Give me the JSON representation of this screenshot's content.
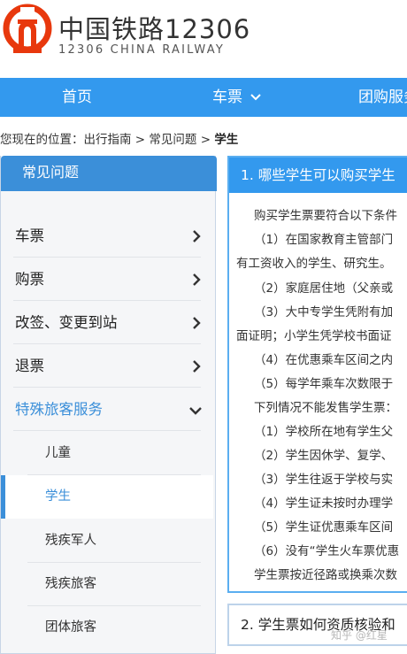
{
  "header": {
    "title_cn": "中国铁路12306",
    "title_en": "12306 CHINA RAILWAY",
    "logo_icon": "china-railway-logo-icon",
    "brand_color": "#e8380d"
  },
  "nav": {
    "items": [
      {
        "label": "首页"
      },
      {
        "label": "车票",
        "icon": "chevron-down-icon"
      },
      {
        "label": "团购服务"
      }
    ],
    "bg_color": "#3399ee"
  },
  "breadcrumb": {
    "prefix": "您现在的位置：",
    "parts": [
      "出行指南",
      "常见问题"
    ],
    "separator": " > ",
    "current": "学生"
  },
  "sidebar": {
    "title": "常见问题",
    "items": [
      {
        "label": "车票",
        "icon": "chevron-right-icon"
      },
      {
        "label": "购票",
        "icon": "chevron-right-icon"
      },
      {
        "label": "改签、变更到站",
        "icon": "chevron-right-icon"
      },
      {
        "label": "退票",
        "icon": "chevron-right-icon"
      },
      {
        "label": "特殊旅客服务",
        "icon": "chevron-down-icon",
        "expanded": true
      }
    ],
    "sub_items": [
      {
        "label": "儿童"
      },
      {
        "label": "学生",
        "active": true
      },
      {
        "label": "残疾军人"
      },
      {
        "label": "残疾旅客"
      },
      {
        "label": "团体旅客"
      }
    ],
    "accent_color": "#3b8fd9"
  },
  "content": {
    "q1_title": "1. 哪些学生可以购买学生",
    "lines": [
      "购买学生票要符合以下条件",
      "（1）在国家教育主管部门",
      "有工资收入的学生、研究生。",
      "（2）家庭居住地（父亲或",
      "（3）大中专学生凭附有加",
      "面证明；小学生凭学校书面证",
      "（4）在优惠乘车区间之内",
      "（5）每学年乘车次数限于",
      "下列情况不能发售学生票：",
      "（1）学校所在地有学生父",
      "（2）学生因休学、复学、",
      "（3）学生往返于学校与实",
      "（4）学生证未按时办理学",
      "（5）学生证优惠乘车区间",
      "（6）没有“学生火车票优惠",
      "学生票按近径路或换乘次数"
    ],
    "q2_title": "2. 学生票如何资质核验和"
  },
  "watermark": "知乎 @红星"
}
